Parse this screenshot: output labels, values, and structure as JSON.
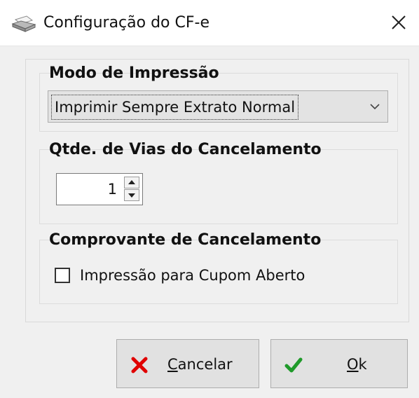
{
  "window": {
    "title": "Configuração do CF-e",
    "title_icon": "printer-icon",
    "close_glyph": "✕"
  },
  "print_mode": {
    "group_title": "Modo de Impressão",
    "selected_option": "Imprimir Sempre Extrato Normal"
  },
  "cancel_copies": {
    "group_title": "Qtde. de Vias do Cancelamento",
    "value": "1"
  },
  "cancel_receipt": {
    "group_title": "Comprovante de Cancelamento",
    "checkbox_label": "Impressão para Cupom Aberto",
    "checked": false
  },
  "buttons": {
    "cancel": {
      "mnemonic": "C",
      "rest": "ancelar",
      "icon": "x-icon",
      "icon_color": "#e00000"
    },
    "ok": {
      "mnemonic": "O",
      "rest": "k",
      "icon": "checkmark-icon",
      "icon_color": "#1f9a2a"
    }
  }
}
